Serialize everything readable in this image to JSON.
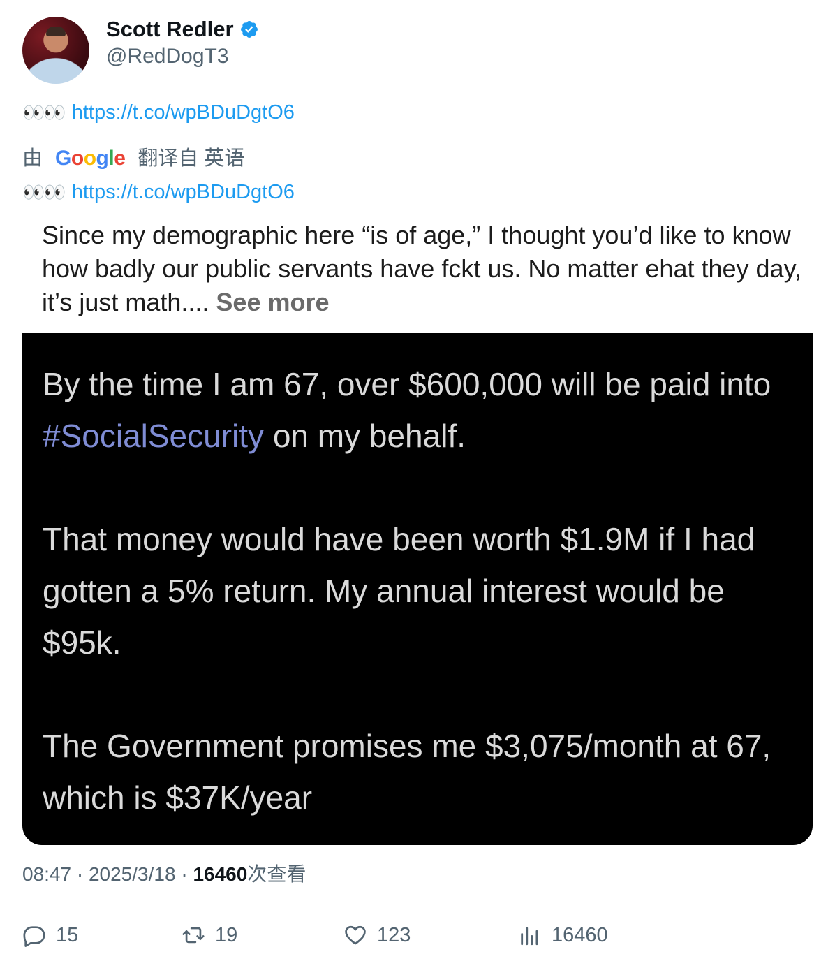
{
  "author": {
    "name": "Scott Redler",
    "handle": "@RedDogT3"
  },
  "tweet": {
    "emoji": "👀👀",
    "link": "https://t.co/wpBDuDgtO6"
  },
  "translation": {
    "prefix": "由",
    "provider": "Google",
    "suffix": "翻译自 英语",
    "emoji": "👀👀",
    "link": "https://t.co/wpBDuDgtO6"
  },
  "quoted_text": {
    "body": "Since my demographic here “is of age,” I thought you’d like to know how badly our public servants have fckt us. No matter ehat they day, it’s just math.... ",
    "see_more": "See more"
  },
  "image_text": {
    "p1_before": "By the time I am 67, over $600,000 will be paid into ",
    "p1_tag": "#SocialSecurity",
    "p1_after": " on my behalf.",
    "p2": "That money would have been worth $1.9M if I had gotten a 5% return. My annual interest would be $95k.",
    "p3": "The Government promises me $3,075/month at 67, which is $37K/year"
  },
  "meta": {
    "time": "08:47",
    "sep1": " · ",
    "date": "2025/3/18",
    "sep2": " · ",
    "views": "16460",
    "views_label": "次查看"
  },
  "actions": {
    "replies": "15",
    "retweets": "19",
    "likes": "123",
    "views": "16460"
  },
  "colors": {
    "link": "#1d9bf0",
    "verified": "#1d9bf0",
    "secondary": "#536471"
  }
}
